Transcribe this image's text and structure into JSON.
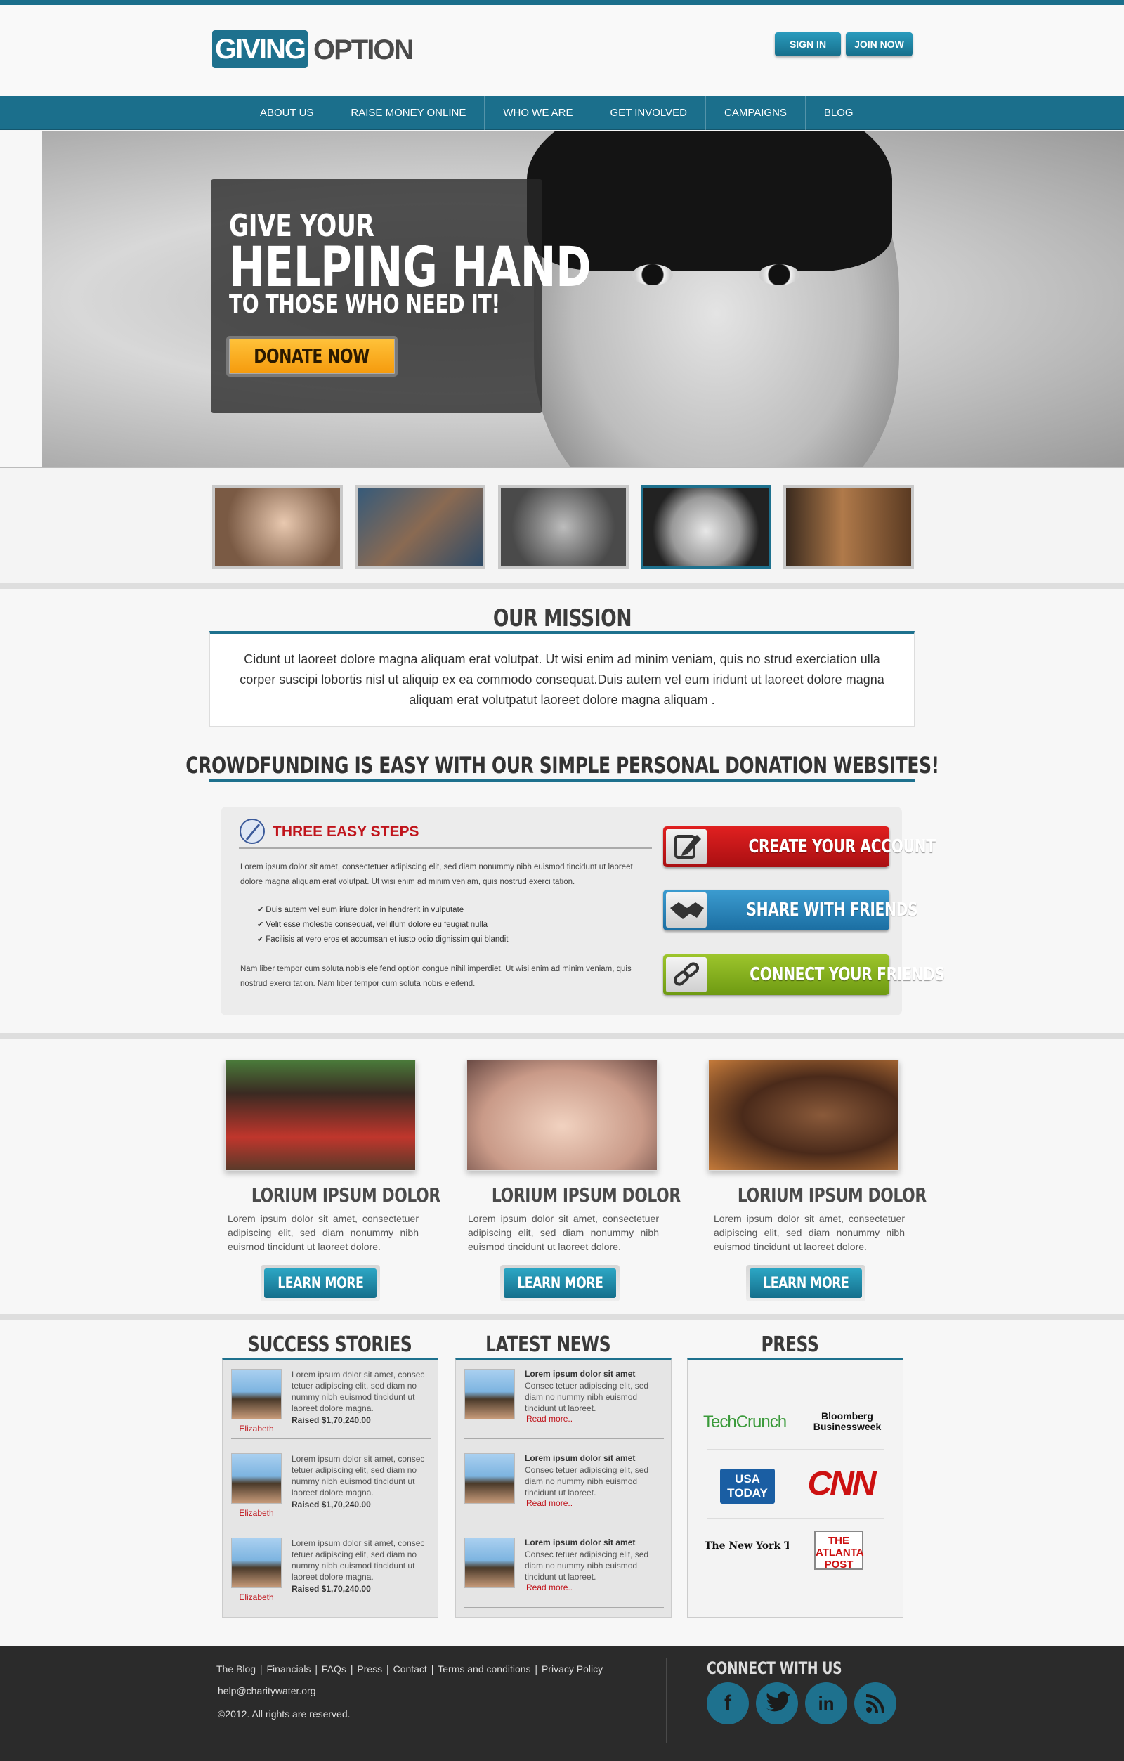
{
  "brand": {
    "logo_box": "GIVING",
    "logo_rest": "OPTION",
    "accent": "#1e718e"
  },
  "header": {
    "sign_in": "SIGN IN",
    "join_now": "JOIN NOW"
  },
  "nav": [
    "ABOUT US",
    "RAISE MONEY ONLINE",
    "WHO WE ARE",
    "GET INVOLVED",
    "CAMPAIGNS",
    "BLOG"
  ],
  "hero": {
    "line1": "GIVE YOUR",
    "line2": "HELPING HAND",
    "line3": "TO THOSE WHO NEED IT!",
    "donate": "DONATE NOW"
  },
  "mission": {
    "title": "OUR MISSION",
    "text": "Cidunt ut laoreet dolore magna aliquam erat volutpat. Ut wisi enim ad minim veniam, quis no strud exerciation ulla corper suscipi lobortis nisl ut aliquip ex ea commodo consequat.Duis autem vel eum iridunt ut laoreet dolore magna aliquam erat volutpatut laoreet dolore magna aliquam ."
  },
  "crowd": {
    "title": "CROWDFUNDING IS EASY WITH OUR SIMPLE PERSONAL DONATION WEBSITES!"
  },
  "steps": {
    "title": "THREE EASY STEPS",
    "p1": "Lorem ipsum dolor sit amet, consectetuer adipiscing elit, sed diam nonummy nibh euismod tincidunt ut laoreet dolore magna aliquam erat volutpat. Ut wisi enim ad minim veniam, quis nostrud exerci tation.",
    "bullets": [
      "Duis autem vel eum iriure dolor in hendrerit in vulputate",
      "Velit esse molestie consequat, vel illum dolore eu feugiat nulla",
      "Facilisis at vero eros et accumsan et iusto odio dignissim qui blandit"
    ],
    "p2": "Nam liber tempor cum soluta nobis eleifend option congue nihil imperdiet. Ut wisi enim ad minim veniam, quis nostrud exerci tation. Nam liber tempor cum soluta nobis eleifend.",
    "buttons": [
      "CREATE YOUR ACCOUNT",
      "SHARE WITH FRIENDS",
      "CONNECT YOUR FRIENDS"
    ]
  },
  "cards": [
    {
      "title": "LORIUM IPSUM DOLOR",
      "text": "Lorem ipsum dolor sit amet, consectetuer adipiscing elit, sed diam nonummy nibh euismod tincidunt ut laoreet dolore.",
      "button": "LEARN MORE"
    },
    {
      "title": "LORIUM IPSUM DOLOR",
      "text": "Lorem ipsum dolor sit amet, consectetuer adipiscing elit, sed diam nonummy nibh euismod tincidunt ut laoreet dolore.",
      "button": "LEARN MORE"
    },
    {
      "title": "LORIUM IPSUM DOLOR",
      "text": "Lorem ipsum dolor sit amet, consectetuer adipiscing elit, sed diam nonummy nibh euismod tincidunt ut laoreet dolore.",
      "button": "LEARN MORE"
    }
  ],
  "success": {
    "title": "SUCCESS STORIES",
    "items": [
      {
        "name": "Elizabeth",
        "text": "Lorem ipsum dolor sit amet, consec tetuer adipiscing elit, sed diam no nummy nibh euismod tincidunt ut laoreet dolore magna.",
        "raised": "Raised $1,70,240.00"
      },
      {
        "name": "Elizabeth",
        "text": "Lorem ipsum dolor sit amet, consec tetuer adipiscing elit, sed diam no nummy nibh euismod tincidunt ut laoreet dolore magna.",
        "raised": "Raised $1,70,240.00"
      },
      {
        "name": "Elizabeth",
        "text": "Lorem ipsum dolor sit amet, consec tetuer adipiscing elit, sed diam no nummy nibh euismod tincidunt ut laoreet dolore magna.",
        "raised": "Raised $1,70,240.00"
      }
    ]
  },
  "news": {
    "title": "LATEST NEWS",
    "items": [
      {
        "heading": "Lorem ipsum dolor sit amet",
        "text": "Consec tetuer adipiscing elit, sed diam no nummy nibh euismod tincidunt ut laoreet.",
        "more": "Read more.."
      },
      {
        "heading": "Lorem ipsum dolor sit amet",
        "text": "Consec tetuer adipiscing elit, sed diam no nummy nibh euismod tincidunt ut laoreet.",
        "more": "Read more.."
      },
      {
        "heading": "Lorem ipsum dolor sit amet",
        "text": "Consec tetuer adipiscing elit, sed diam no nummy nibh euismod tincidunt ut laoreet.",
        "more": "Read more.."
      }
    ]
  },
  "press": {
    "title": "PRESS",
    "logos": [
      "TechCrunch",
      "Bloomberg Businessweek",
      "USA TODAY",
      "CNN",
      "The New York Times",
      "THE ATLANTA POST"
    ]
  },
  "footer": {
    "links": [
      "The Blog",
      "Financials",
      "FAQs",
      "Press",
      "Contact",
      "Terms and conditions",
      "Privacy Policy"
    ],
    "email": "help@charitywater.org",
    "copyright": "©2012. All rights are reserved.",
    "connect_title": "CONNECT WITH US",
    "social": [
      "facebook-icon",
      "twitter-icon",
      "linkedin-icon",
      "rss-icon"
    ]
  }
}
